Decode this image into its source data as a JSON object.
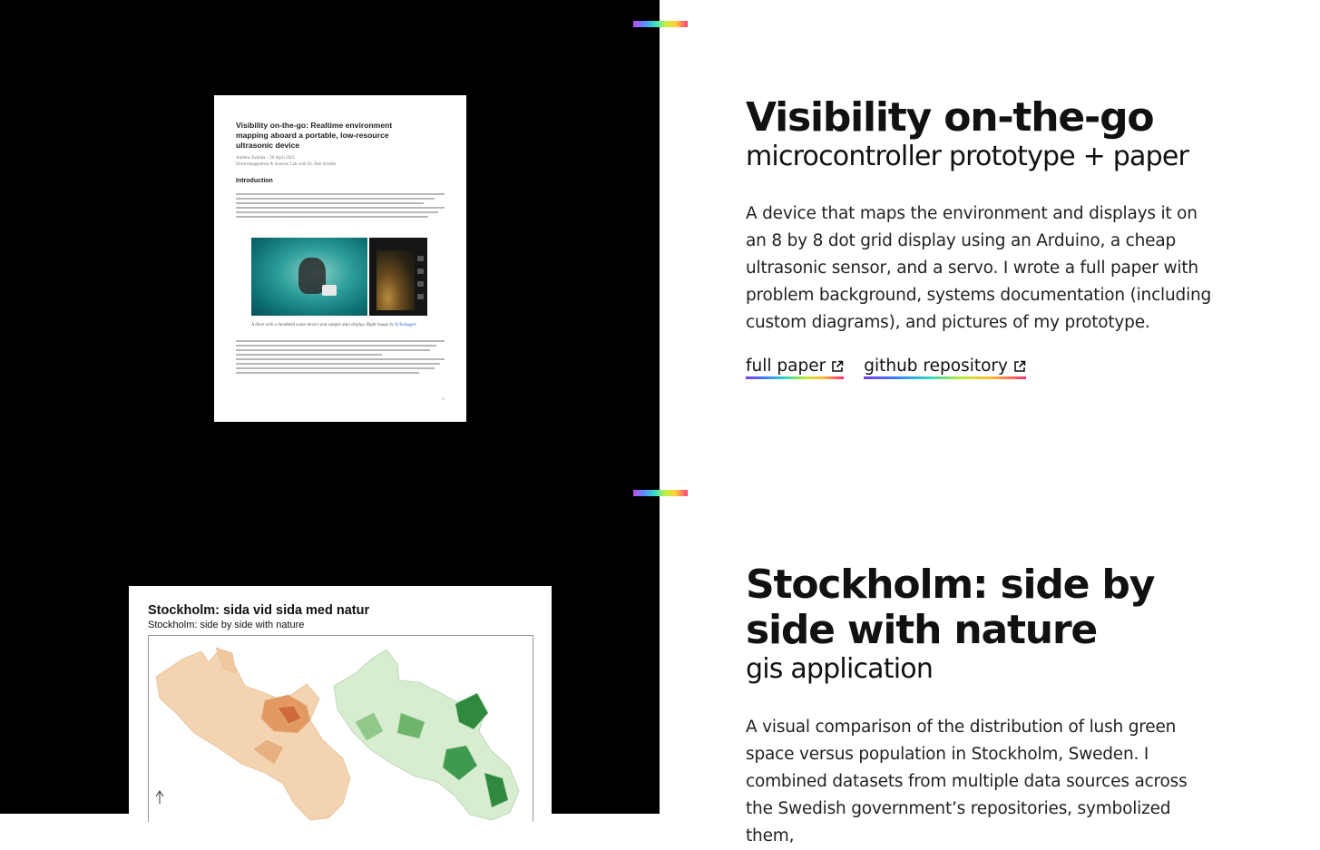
{
  "projects": [
    {
      "title": "Visibility on-the-go",
      "subtitle": "microcontroller prototype + paper",
      "description": "A device that maps the environment and displays it on an 8 by 8 dot grid display using an Arduino, a cheap ultrasonic sensor, and a servo. I wrote a full paper with problem background, systems documentation (including custom diagrams), and pictures of my prototype.",
      "links": [
        {
          "label": "full paper",
          "icon": "external-link-icon"
        },
        {
          "label": "github repository",
          "icon": "external-link-icon"
        }
      ],
      "thumbnail": {
        "paper_title": "Visibility on-the-go: Realtime environment mapping aboard a portable, low-resource ultrasonic device",
        "paper_meta_1": "Andrew Eslinda – 26 April 2021",
        "paper_meta_2": "Electromagnetism & Sensors Lab with Dr. Ben Schafer",
        "paper_section": "Introduction",
        "figure_caption": "A diver with a handheld sonar device and sample data display. Right image by",
        "figure_caption_link": "Echologger.",
        "page_number": "1"
      }
    },
    {
      "title": "Stockholm: side by side with nature",
      "subtitle": "gis application",
      "description": "A visual comparison of the distribution of lush green space versus population in Stockholm, Sweden. I combined datasets from multiple data sources across the Swedish government’s repositories, symbolized them,",
      "thumbnail": {
        "map_title": "Stockholm: sida vid sida med natur",
        "map_subtitle": "Stockholm: side by side with nature"
      }
    }
  ],
  "colors": {
    "left_background": "#000000",
    "right_background": "#ffffff",
    "text": "#111111",
    "accent_gradient": [
      "#c04cf0",
      "#5a8cff",
      "#33e0c8",
      "#c8f03c",
      "#ffcf3a",
      "#ff3d7f"
    ],
    "population_color": "#e8a065",
    "greenspace_color": "#3d9a4f"
  }
}
